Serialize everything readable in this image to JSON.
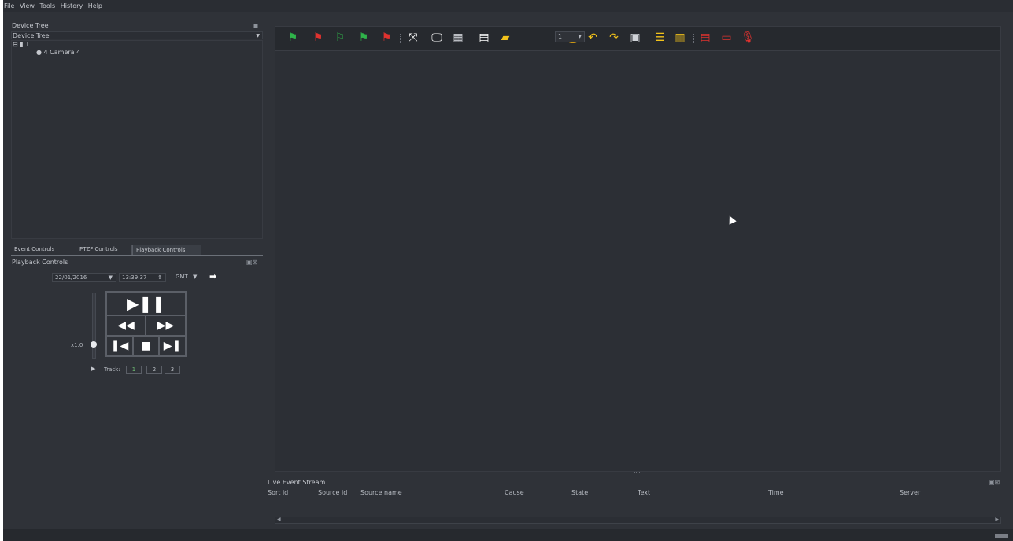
{
  "menu": [
    "File",
    "View",
    "Tools",
    "History",
    "Help"
  ],
  "device_tree": {
    "title": "Device Tree",
    "combo_value": "Device Tree",
    "root_label": "1",
    "camera_label": "4 Camera 4"
  },
  "tabs": [
    "Event Controls",
    "PTZF Controls",
    "Playback Controls"
  ],
  "playback": {
    "title": "Playback Controls",
    "date": "22/01/2016",
    "time": "13:39:37",
    "timezone": "GMT",
    "speed": "x1.0",
    "track_label": "Track:",
    "tracks": [
      "1",
      "2",
      "3"
    ]
  },
  "toolbar": {
    "layout_value": "1"
  },
  "live_event_stream": {
    "title": "Live Event Stream",
    "columns": [
      "Sort id",
      "Source id",
      "Source name",
      "Cause",
      "State",
      "Text",
      "Time",
      "Server"
    ]
  },
  "colors": {
    "background": "#2f3238",
    "toolbar": "#26292e",
    "accent_green": "#2fb34a",
    "accent_red": "#e0322f",
    "accent_yellow": "#f2c21b",
    "accent_blue": "#3aa0e8"
  }
}
